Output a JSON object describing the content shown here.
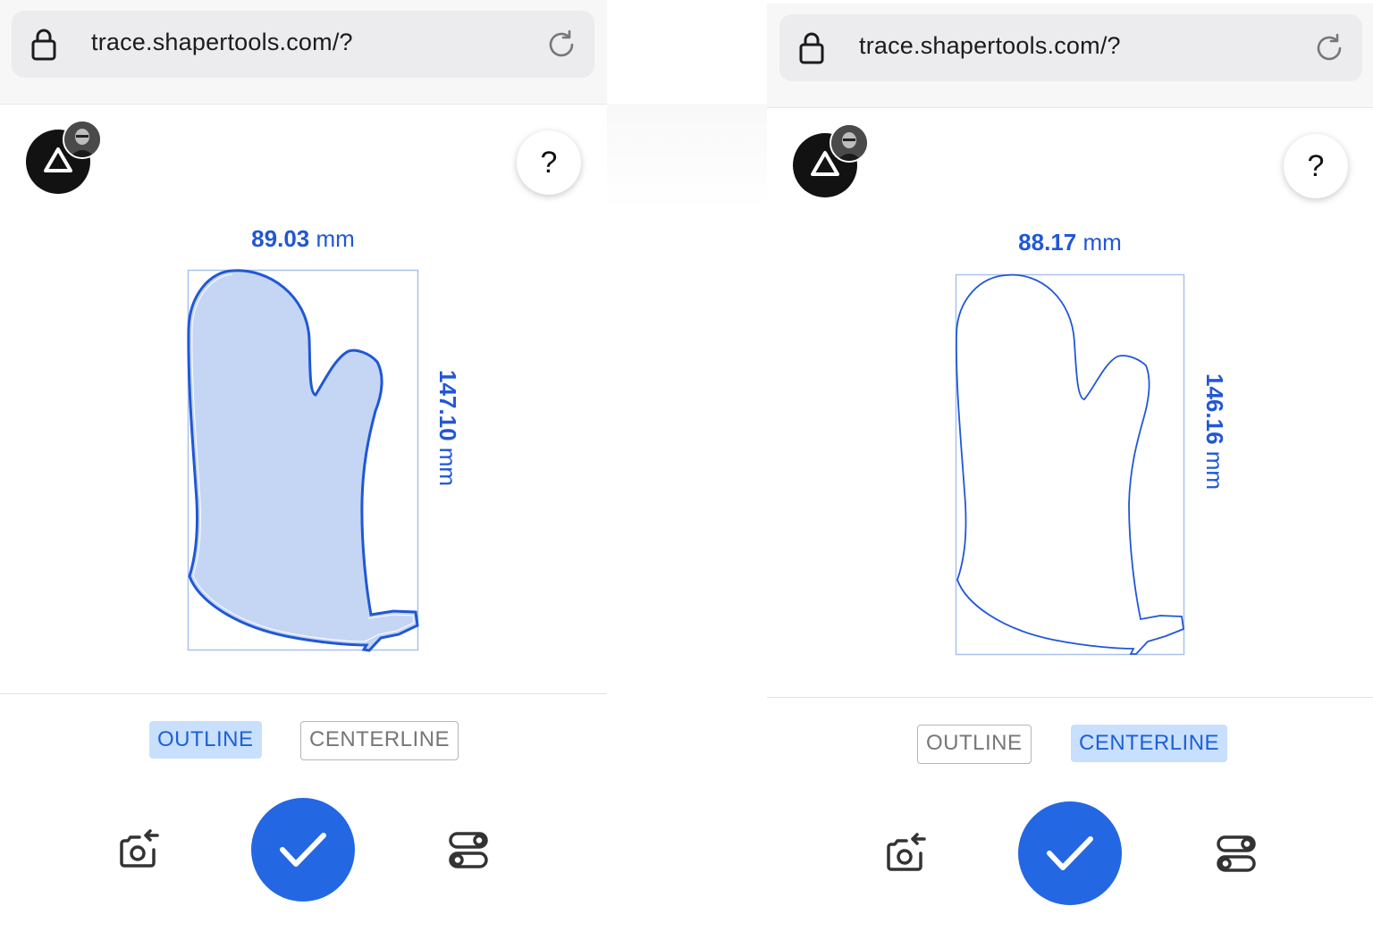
{
  "colors": {
    "accent": "#2157d6",
    "active_bg": "#c8e0fd",
    "confirm": "#2467e3",
    "fill": "#c5d6f4"
  },
  "panels": [
    {
      "url": "trace.shapertools.com/?",
      "width_value": "89.03",
      "width_unit": "mm",
      "height_value": "147.10",
      "height_unit": "mm",
      "mode_outline": "OUTLINE",
      "mode_centerline": "CENTERLINE",
      "active_mode": "OUTLINE",
      "help": "?"
    },
    {
      "url": "trace.shapertools.com/?",
      "width_value": "88.17",
      "width_unit": "mm",
      "height_value": "146.16",
      "height_unit": "mm",
      "mode_outline": "OUTLINE",
      "mode_centerline": "CENTERLINE",
      "active_mode": "CENTERLINE",
      "help": "?"
    }
  ],
  "icons": {
    "lock": "lock-icon",
    "reload": "reload-icon",
    "logo": "shaper-triangle-icon",
    "camera": "retake-camera-icon",
    "confirm": "checkmark-icon",
    "settings": "settings-toggles-icon"
  }
}
